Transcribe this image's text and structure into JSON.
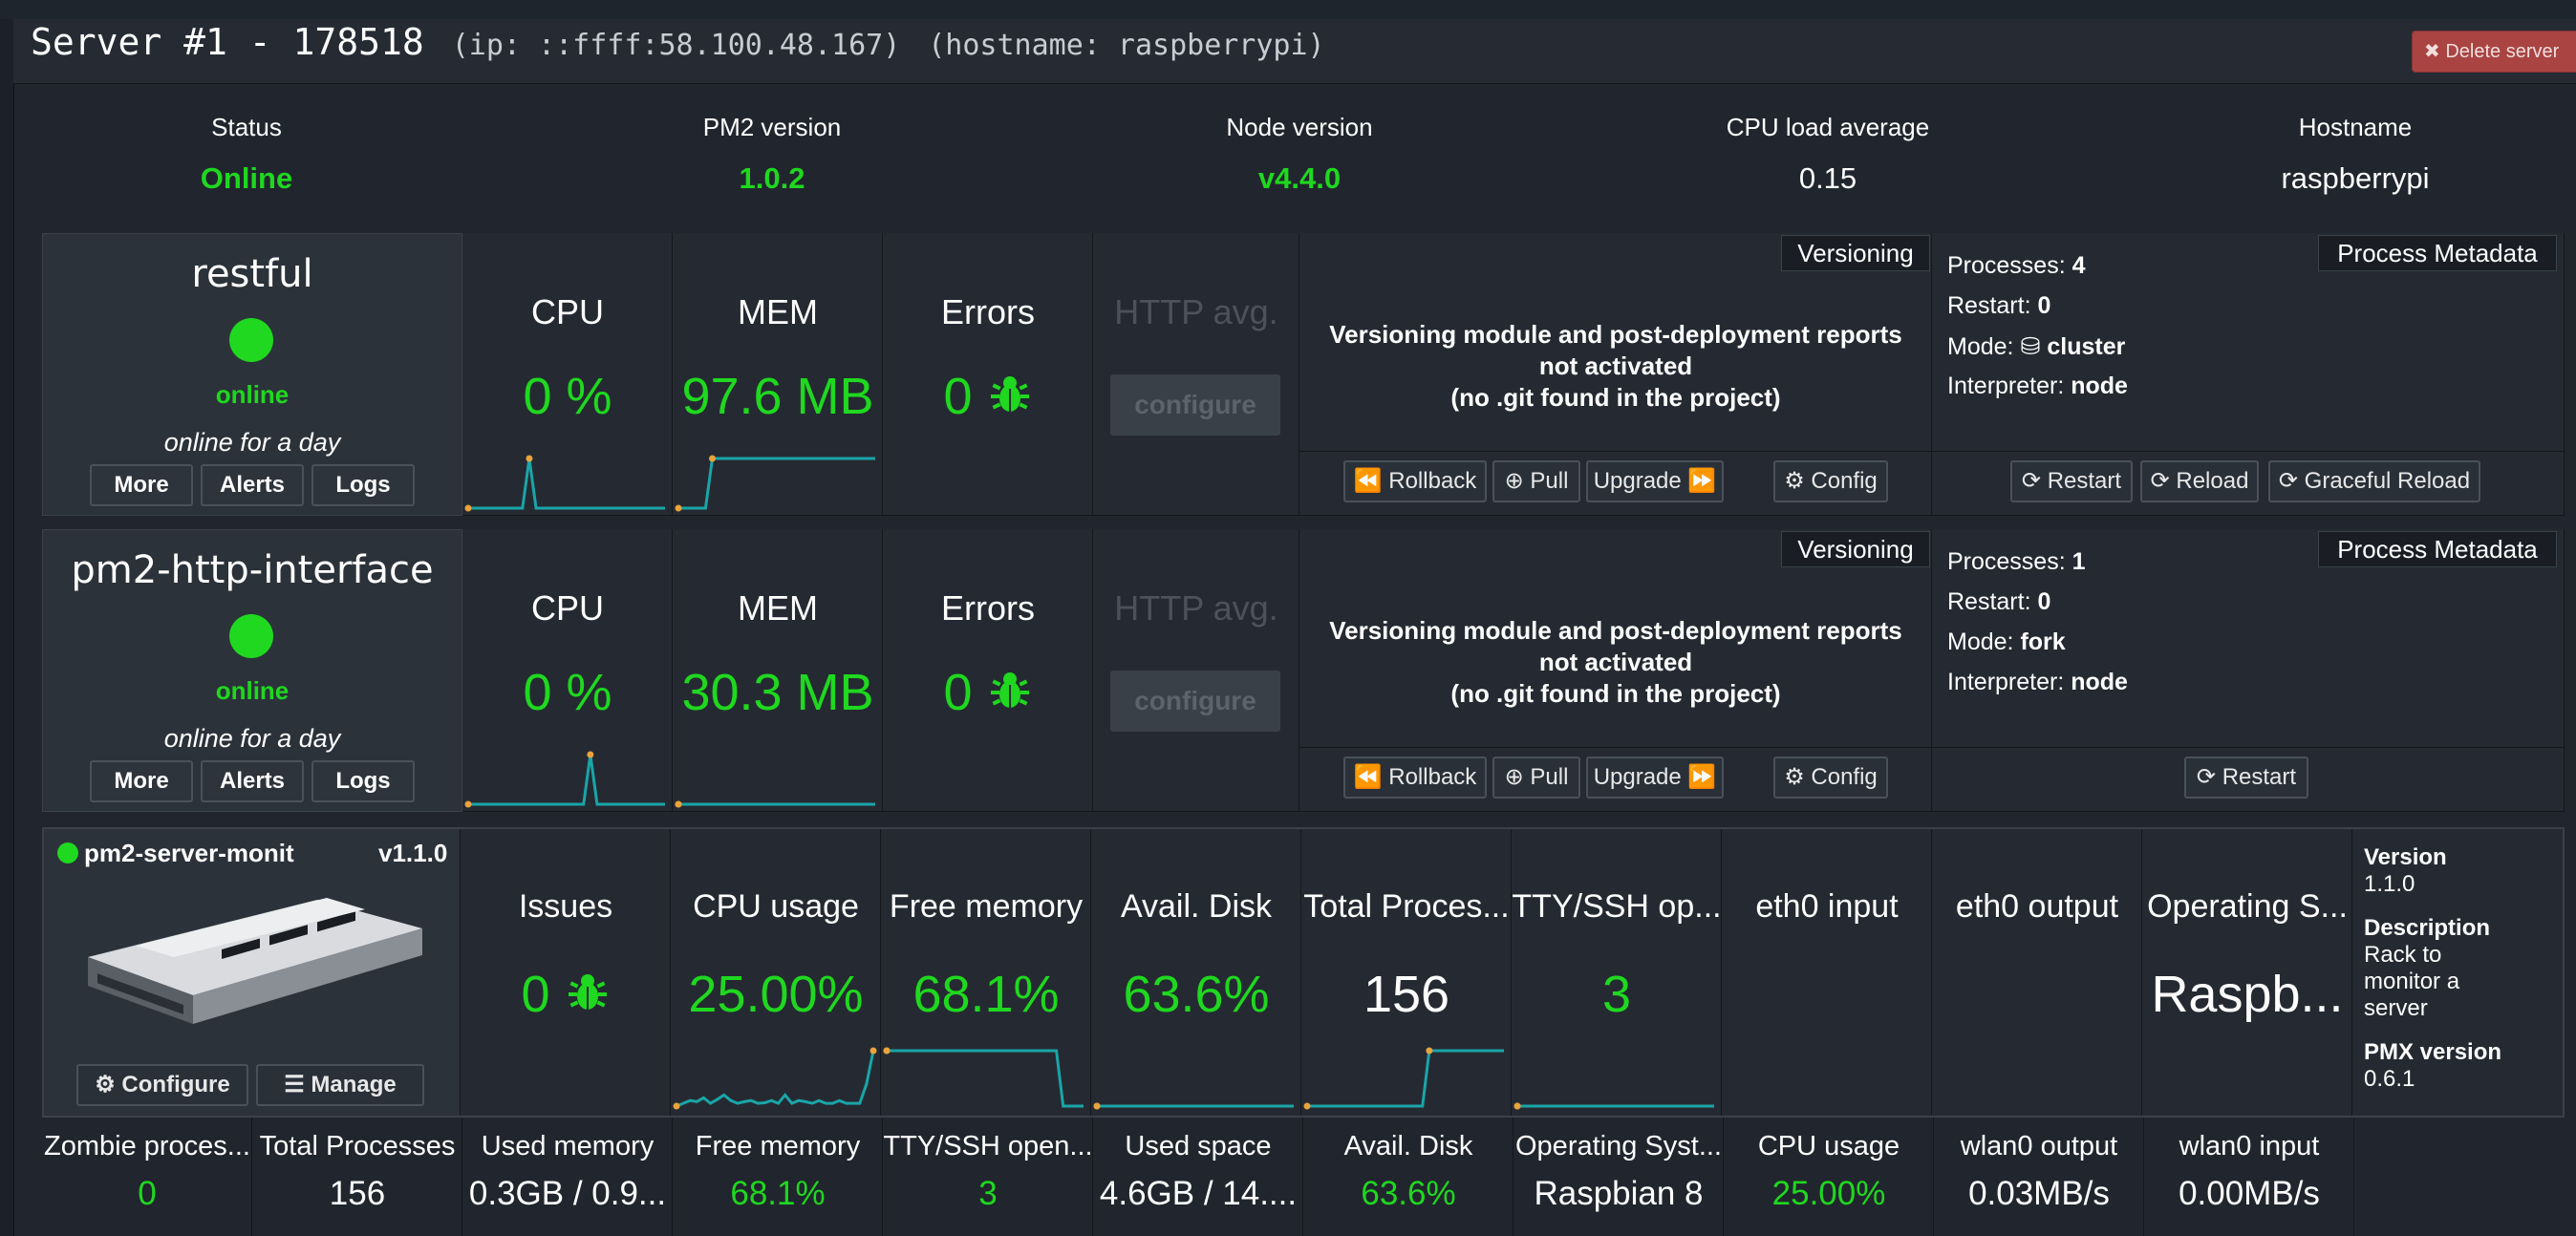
{
  "header": {
    "title": "Server #1 - 178518",
    "ip": "(ip: ::ffff:58.100.48.167)",
    "hostname": "(hostname: raspberrypi)",
    "delete_label": "Delete server"
  },
  "summary": [
    {
      "label": "Status",
      "value": "Online"
    },
    {
      "label": "PM2 version",
      "value": "1.0.2"
    },
    {
      "label": "Node version",
      "value": "v4.4.0"
    },
    {
      "label": "CPU load average",
      "value": "0.15"
    },
    {
      "label": "Hostname",
      "value": "raspberrypi"
    }
  ],
  "common": {
    "cpu_label": "CPU",
    "mem_label": "MEM",
    "errors_label": "Errors",
    "http_label": "HTTP avg.",
    "configure_label": "configure",
    "more_label": "More",
    "alerts_label": "Alerts",
    "logs_label": "Logs",
    "versioning_tag": "Versioning",
    "metadata_tag": "Process Metadata",
    "versioning_line1": "Versioning module and post-deployment reports",
    "versioning_line2": "not activated",
    "versioning_line3": "(no .git found in the project)",
    "rollback_label": "Rollback",
    "pull_label": "Pull",
    "upgrade_label": "Upgrade",
    "config_label": "Config",
    "restart_label": "Restart",
    "reload_label": "Reload",
    "graceful_label": "Graceful Reload",
    "processes_label": "Processes:",
    "restart_count_label": "Restart:",
    "mode_label": "Mode:",
    "interpreter_label": "Interpreter:"
  },
  "processes": [
    {
      "name": "restful",
      "status": "online",
      "uptime": "online for a day",
      "cpu": "0 %",
      "mem": "97.6 MB",
      "errors": "0",
      "meta": {
        "processes": "4",
        "restart": "0",
        "mode": "cluster",
        "interpreter": "node"
      },
      "cpu_spark": [
        0,
        0,
        0,
        0,
        0,
        0,
        0,
        0,
        0,
        1,
        0,
        0,
        0,
        0,
        0,
        0,
        0,
        0,
        0,
        0,
        0,
        0,
        0,
        0,
        0,
        0,
        0,
        0,
        0,
        0
      ],
      "mem_spark": [
        0,
        0,
        0,
        0,
        0,
        1,
        1,
        1,
        1,
        1,
        1,
        1,
        1,
        1,
        1,
        1,
        1,
        1,
        1,
        1,
        1,
        1,
        1,
        1,
        1,
        1,
        1,
        1,
        1,
        1
      ]
    },
    {
      "name": "pm2-http-interface",
      "status": "online",
      "uptime": "online for a day",
      "cpu": "0 %",
      "mem": "30.3 MB",
      "errors": "0",
      "meta": {
        "processes": "1",
        "restart": "0",
        "mode": "fork",
        "interpreter": "node"
      },
      "cpu_spark": [
        0,
        0,
        0,
        0,
        0,
        0,
        0,
        0,
        0,
        0,
        0,
        0,
        0,
        0,
        0,
        0,
        0,
        0,
        1,
        0,
        0,
        0,
        0,
        0,
        0,
        0,
        0,
        0,
        0,
        0
      ],
      "mem_spark": [
        0,
        0,
        0,
        0,
        0,
        0,
        0,
        0,
        0,
        0,
        0,
        0,
        0,
        0,
        0,
        0,
        0,
        0,
        0,
        0,
        0,
        0,
        0,
        0,
        0,
        0,
        0,
        0,
        0,
        0
      ]
    }
  ],
  "module": {
    "name": "pm2-server-monit",
    "version": "v1.1.0",
    "configure_label": "Configure",
    "manage_label": "Manage",
    "metrics": [
      {
        "label": "Issues",
        "value": "0"
      },
      {
        "label": "CPU usage",
        "value": "25.00%"
      },
      {
        "label": "Free memory",
        "value": "68.1%"
      },
      {
        "label": "Avail. Disk",
        "value": "63.6%"
      },
      {
        "label": "Total Proces...",
        "value": "156"
      },
      {
        "label": "TTY/SSH op...",
        "value": "3"
      },
      {
        "label": "eth0 input",
        "value": ""
      },
      {
        "label": "eth0 output",
        "value": ""
      },
      {
        "label": "Operating S...",
        "value": "Raspb..."
      }
    ],
    "info": {
      "version_label": "Version",
      "version": "1.1.0",
      "description_label": "Description",
      "description": "Rack to monitor a server",
      "pmx_label": "PMX version",
      "pmx": "0.6.1"
    },
    "cpu_spark": [
      0,
      0.05,
      0.1,
      0.08,
      0.15,
      0.05,
      0.12,
      0.2,
      0.1,
      0.05,
      0.08,
      0.1,
      0.05,
      0.06,
      0.1,
      0.05,
      0.2,
      0.05,
      0.1,
      0.08,
      0.05,
      0.1,
      0.05,
      0.05,
      0.1,
      0.05,
      0.05,
      0.05,
      0.4,
      1
    ],
    "mem_spark": [
      1,
      1,
      1,
      1,
      1,
      1,
      1,
      1,
      1,
      1,
      1,
      1,
      1,
      1,
      1,
      1,
      1,
      1,
      1,
      1,
      1,
      1,
      1,
      1,
      1,
      1,
      0,
      0,
      0,
      0
    ],
    "disk_spark": [
      0,
      0,
      0,
      0,
      0,
      0,
      0,
      0,
      0,
      0,
      0,
      0,
      0,
      0,
      0,
      0,
      0,
      0,
      0,
      0,
      0,
      0,
      0,
      0,
      0,
      0,
      0,
      0,
      0,
      0
    ],
    "total_spark": [
      0,
      0,
      0,
      0,
      0,
      0,
      0,
      0,
      0,
      0,
      0,
      0,
      0,
      0,
      0,
      0,
      0,
      0,
      1,
      1,
      1,
      1,
      1,
      1,
      1,
      1,
      1,
      1,
      1,
      1
    ],
    "tty_spark": [
      0,
      0,
      0,
      0,
      0,
      0,
      0,
      0,
      0,
      0,
      0,
      0,
      0,
      0,
      0,
      0,
      0,
      0,
      0,
      0,
      0,
      0,
      0,
      0,
      0,
      0,
      0,
      0,
      0,
      0
    ]
  },
  "bottom": [
    {
      "label": "Zombie proces...",
      "value": "0",
      "color": "green"
    },
    {
      "label": "Total Processes",
      "value": "156",
      "color": "white"
    },
    {
      "label": "Used memory",
      "value": "0.3GB / 0.9...",
      "color": "white"
    },
    {
      "label": "Free memory",
      "value": "68.1%",
      "color": "green"
    },
    {
      "label": "TTY/SSH open...",
      "value": "3",
      "color": "green"
    },
    {
      "label": "Used space",
      "value": "4.6GB / 14....",
      "color": "white"
    },
    {
      "label": "Avail. Disk",
      "value": "63.6%",
      "color": "green"
    },
    {
      "label": "Operating Syst...",
      "value": "Raspbian 8",
      "color": "white"
    },
    {
      "label": "CPU usage",
      "value": "25.00%",
      "color": "green"
    },
    {
      "label": "wlan0 output",
      "value": "0.03MB/s",
      "color": "white"
    },
    {
      "label": "wlan0 input",
      "value": "0.00MB/s",
      "color": "white"
    }
  ],
  "colors": {
    "accent_green": "#1fd81f",
    "spark_line": "#1aa5a8",
    "spark_dot": "#e8a33c",
    "danger": "#a94442"
  }
}
